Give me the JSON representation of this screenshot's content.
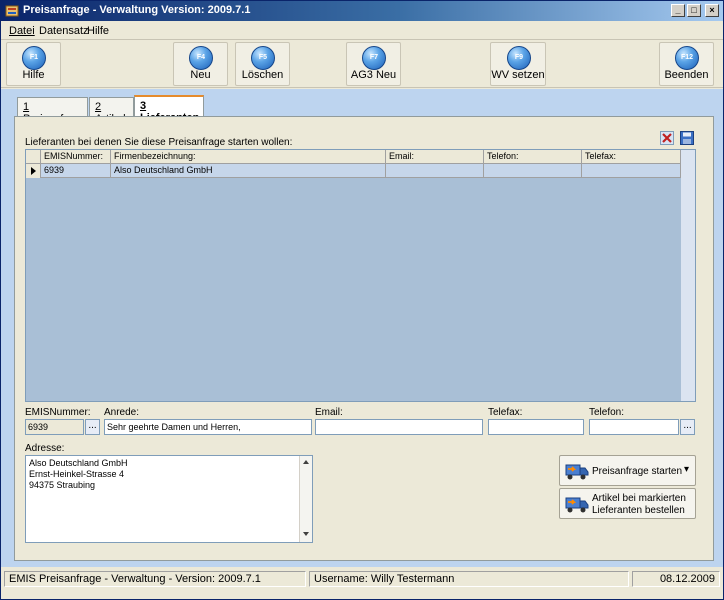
{
  "window": {
    "title": "Preisanfrage - Verwaltung Version: 2009.7.1",
    "controls": {
      "minimize": "_",
      "maximize": "□",
      "close": "×"
    }
  },
  "menu": [
    {
      "label": "Datei",
      "accel": "D"
    },
    {
      "label": "Datensatz",
      "accel": ""
    },
    {
      "label": "Hilfe",
      "accel": ""
    }
  ],
  "toolbar": [
    {
      "key": "F1",
      "label": "Hilfe"
    },
    {
      "key": "F4",
      "label": "Neu"
    },
    {
      "key": "F5",
      "label": "Löschen"
    },
    {
      "key": "F7",
      "label": "AG3 Neu"
    },
    {
      "key": "F9",
      "label": "WV setzen"
    },
    {
      "key": "F12",
      "label": "Beenden"
    }
  ],
  "tabs": [
    {
      "num": "1",
      "label": "Preisanfrage"
    },
    {
      "num": "2",
      "label": "Artikel"
    },
    {
      "num": "3",
      "label": "Lieferanten",
      "active": true
    }
  ],
  "grid": {
    "caption": "Lieferanten bei denen Sie diese Preisanfrage starten wollen:",
    "columns": [
      "EMISNummer:",
      "Firmenbezeichnung:",
      "Email:",
      "Telefon:",
      "Telefax:"
    ],
    "rows": [
      {
        "emis": "6939",
        "firma": "Also Deutschland GmbH",
        "email": "",
        "telefon": "",
        "telefax": ""
      }
    ]
  },
  "form": {
    "emis_label": "EMISNummer:",
    "emis_value": "6939",
    "anrede_label": "Anrede:",
    "anrede_value": "Sehr geehrte Damen und Herren,",
    "email_label": "Email:",
    "email_value": "",
    "telefax_label": "Telefax:",
    "telefax_value": "",
    "telefon_label": "Telefon:",
    "telefon_value": "",
    "dots": "...",
    "adresse_label": "Adresse:",
    "adresse_lines": [
      "Also Deutschland GmbH",
      "Ernst-Heinkel-Strasse 4",
      "94375 Straubing"
    ]
  },
  "actions": {
    "start_label": "Preisanfrage starten",
    "start_dropdown": "▾",
    "order_line1": "Artikel bei markierten",
    "order_line2": "Lieferanten bestellen"
  },
  "status": {
    "app": "EMIS Preisanfrage - Verwaltung - Version: 2009.7.1",
    "user": "Username: Willy Testermann",
    "date": "08.12.2009"
  },
  "icons": {
    "delete": "delete-x-icon",
    "save": "save-disk-icon"
  },
  "colors": {
    "titlebar": "#0a246a",
    "panel": "#bdd4ef",
    "selected_row": "#c6d6ea",
    "tab_active_accent": "#e68b2c"
  }
}
